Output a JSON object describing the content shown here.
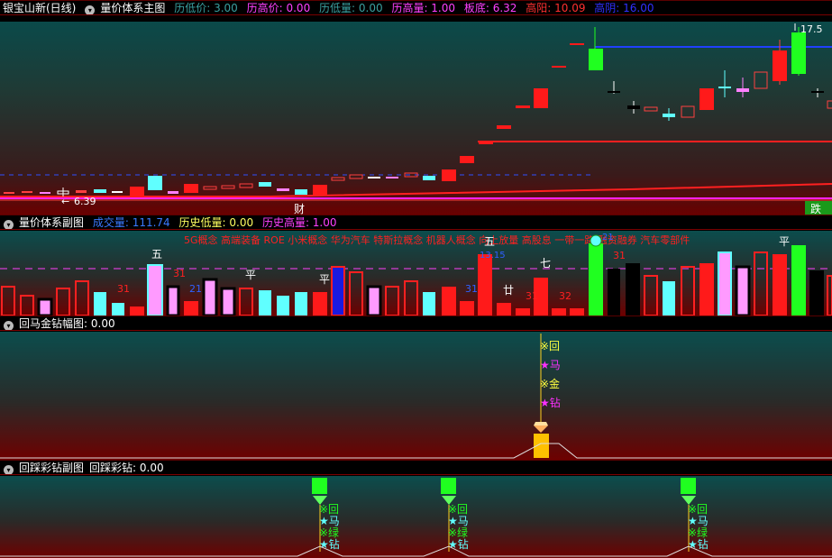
{
  "main_header": {
    "stock": "银宝山新(日线)",
    "indicator": "量价体系主图",
    "fields": [
      {
        "text": "历低价: 3.00",
        "color": "#3aa0a0"
      },
      {
        "text": "历高价: 0.00",
        "color": "#ff40ff"
      },
      {
        "text": "历低量: 0.00",
        "color": "#3aa0a0"
      },
      {
        "text": "历高量: 1.00",
        "color": "#ff40ff"
      },
      {
        "text": "板底: 6.32",
        "color": "#ff40ff"
      },
      {
        "text": "高阳: 10.09",
        "color": "#ff3030"
      },
      {
        "text": "高阴: 16.00",
        "color": "#3030ff"
      }
    ]
  },
  "main_chart": {
    "high_label": "17.5",
    "low_label": "6.39",
    "marker_cai": "财",
    "marker_die": "跌"
  },
  "sub1_header": {
    "indicator": "量价体系副图",
    "fields": [
      {
        "text": "成交量: 111.74",
        "color": "#3a7aff"
      },
      {
        "text": "历史低量: 0.00",
        "color": "#ffff60"
      },
      {
        "text": "历史高量: 1.00",
        "color": "#ff40ff"
      }
    ]
  },
  "sub1_chart": {
    "concept_ticker": "5G概念 高端装备 ROE 小米概念 华为汽车 特斯拉概念 机器人概念 向上放量 高股息 一带一路 融资融券 汽车零部件",
    "labels": [
      "五",
      "31",
      "平",
      "21",
      "31",
      "平",
      "31",
      "五",
      "13.15",
      "廿",
      "31",
      "七",
      "32",
      "21",
      "31",
      "平"
    ]
  },
  "sub2_header": {
    "indicator": "回马金钻幅图",
    "value": ": 0.00"
  },
  "sub2_chart": {
    "signal_lines": [
      "※回",
      "★马",
      "※金",
      "★钻"
    ]
  },
  "sub3_header": {
    "indicator": "回踩彩钻副图",
    "value_label": "回踩彩钻: 0.00"
  },
  "sub3_chart": {
    "signal_lines": [
      "※回",
      "★马",
      "※绿",
      "★钻"
    ]
  }
}
